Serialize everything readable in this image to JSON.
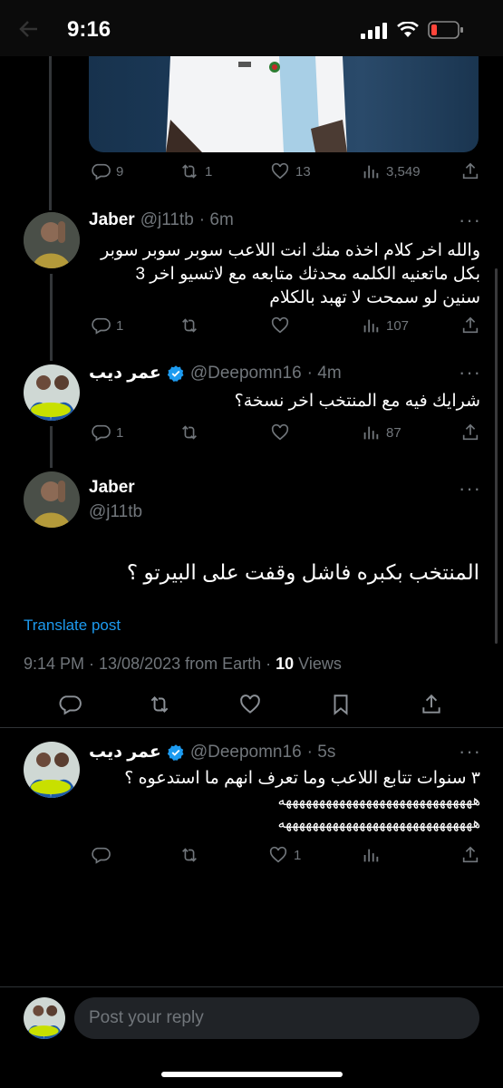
{
  "status_bar": {
    "time": "9:16"
  },
  "top_tweet_actions": {
    "replies": "9",
    "retweets": "1",
    "likes": "13",
    "views": "3,549"
  },
  "replies": [
    {
      "name": "Jaber",
      "handle": "@j11tb",
      "time": "· 6m",
      "text_lines": [
        "والله اخر كلام اخذه منك انت اللاعب سوبر سوبر سوبر",
        "بكل ماتعنيه الكلمه محدثك متابعه مع لاتسيو اخر 3",
        "سنين لو سمحت لا تهبد بالكلام"
      ],
      "replies": "1",
      "views": "107"
    },
    {
      "name": "عمر ديب",
      "handle": "@Deepomn16",
      "time": "· 4m",
      "text_lines": [
        "شرايك فيه مع المنتخب اخر نسخة؟"
      ],
      "replies": "1",
      "views": "87"
    }
  ],
  "main_tweet": {
    "name": "Jaber",
    "handle": "@j11tb",
    "text": "المنتخب بكبره فاشل وقفت على البيرتو ؟",
    "translate": "Translate post",
    "meta_time": "9:14 PM · 13/08/2023 from Earth · ",
    "views_count": "10",
    "views_label": " Views"
  },
  "last_reply": {
    "name": "عمر ديب",
    "handle": "@Deepomn16",
    "time": "· 5s",
    "text_lines": [
      "٣ سنوات تتابع اللاعب وما تعرف انهم ما استدعوه ؟",
      "هههههههههههههههههههههههههههههه",
      "هههههههههههههههههههههههههههههه"
    ],
    "likes": "1"
  },
  "reply_box": {
    "placeholder": "Post your reply"
  },
  "colors": {
    "accent": "#1d9bf0",
    "background": "#000000",
    "muted": "#71767b"
  },
  "icons": [
    "back-arrow-icon",
    "signal-icon",
    "wifi-icon",
    "battery-icon",
    "reply-icon",
    "retweet-icon",
    "like-icon",
    "views-icon",
    "share-icon",
    "bookmark-icon",
    "verified-icon",
    "more-icon"
  ]
}
